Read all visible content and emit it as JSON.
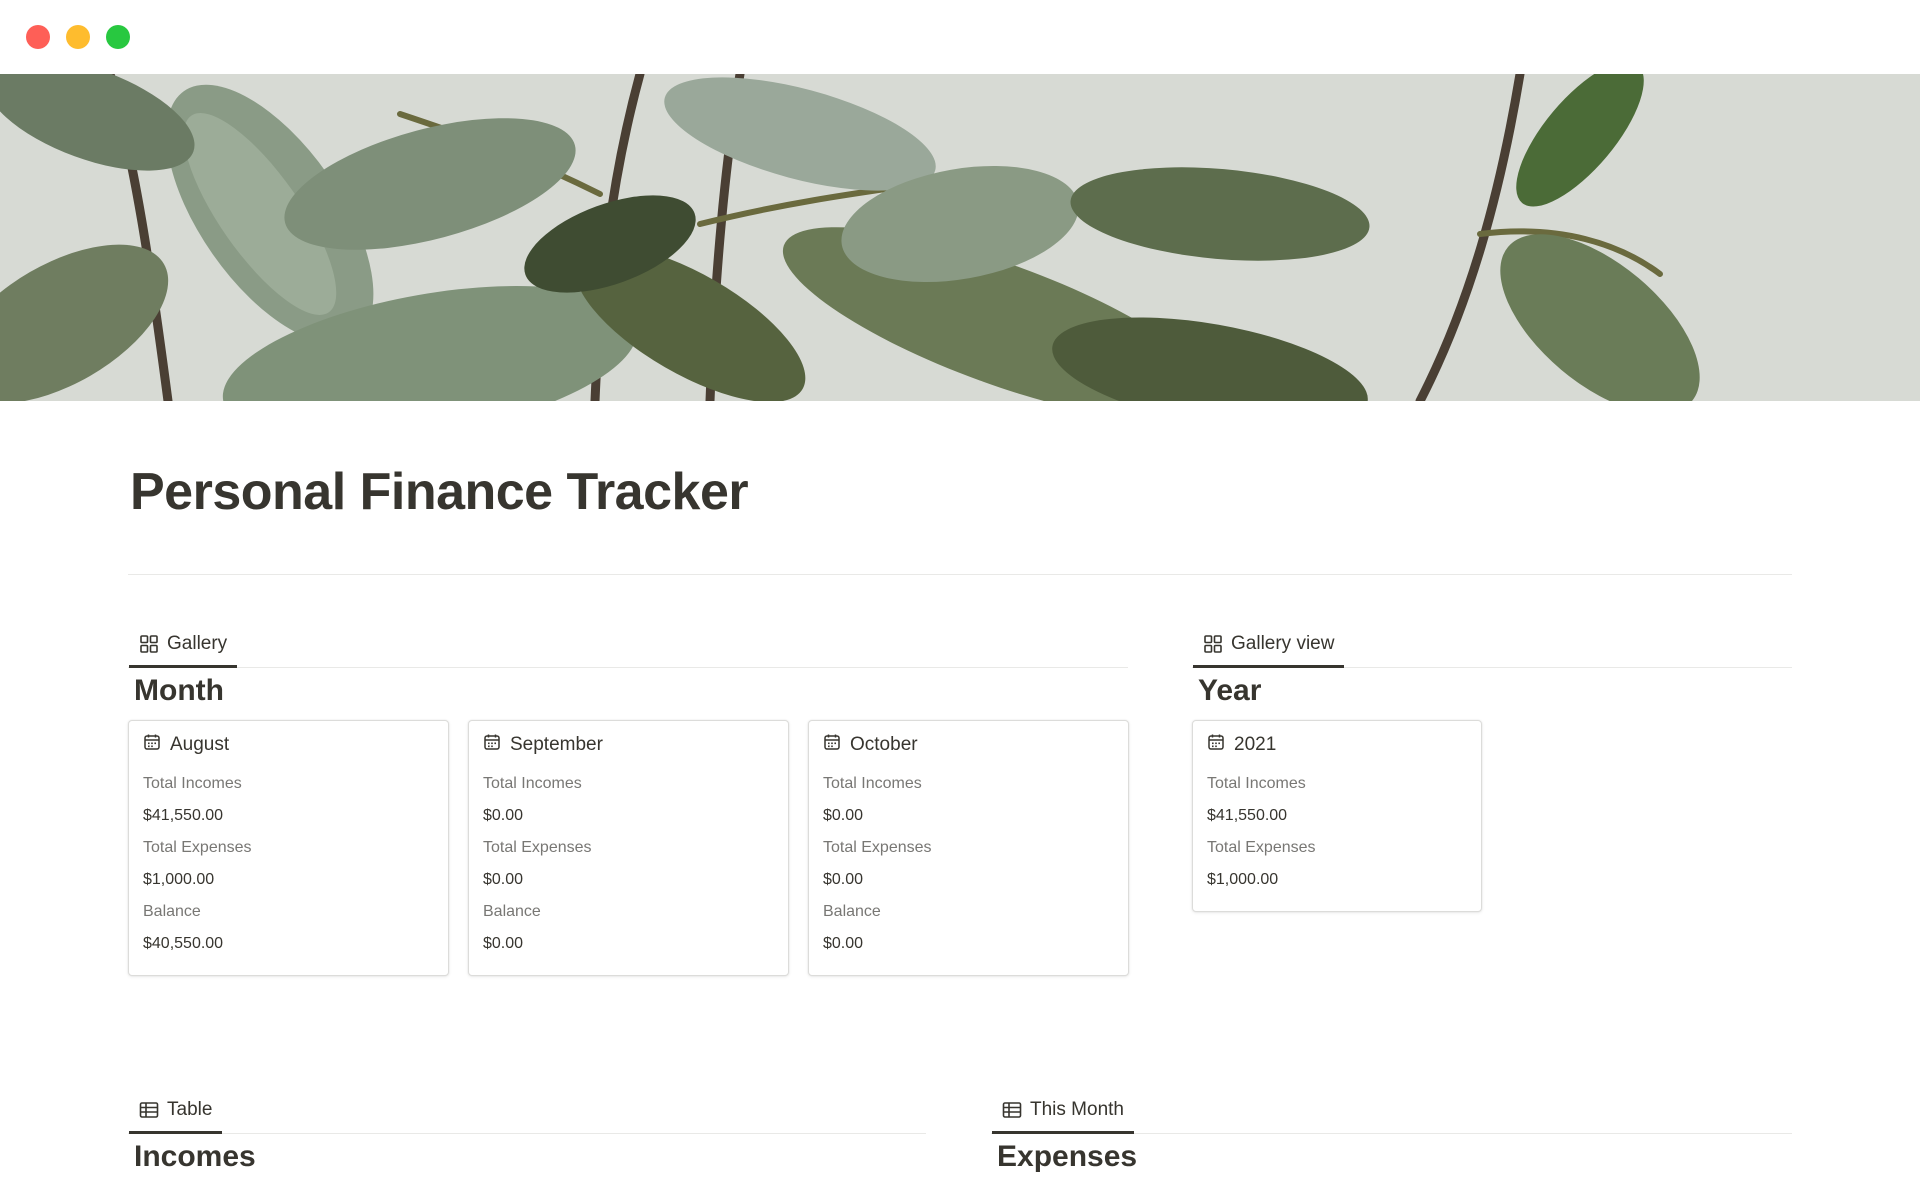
{
  "window": {
    "controls": [
      "close",
      "minimize",
      "zoom"
    ]
  },
  "cover": {
    "description_icon": "cover-image"
  },
  "page": {
    "title": "Personal Finance Tracker"
  },
  "month_view": {
    "tab_icon": "gallery-icon",
    "tab_label": "Gallery",
    "title": "Month",
    "cards": [
      {
        "name": "August",
        "total_incomes_label": "Total Incomes",
        "total_incomes": "$41,550.00",
        "total_expenses_label": "Total Expenses",
        "total_expenses": "$1,000.00",
        "balance_label": "Balance",
        "balance": "$40,550.00"
      },
      {
        "name": "September",
        "total_incomes_label": "Total Incomes",
        "total_incomes": "$0.00",
        "total_expenses_label": "Total Expenses",
        "total_expenses": "$0.00",
        "balance_label": "Balance",
        "balance": "$0.00"
      },
      {
        "name": "October",
        "total_incomes_label": "Total Incomes",
        "total_incomes": "$0.00",
        "total_expenses_label": "Total Expenses",
        "total_expenses": "$0.00",
        "balance_label": "Balance",
        "balance": "$0.00"
      }
    ]
  },
  "year_view": {
    "tab_icon": "gallery-icon",
    "tab_label": "Gallery view",
    "title": "Year",
    "cards": [
      {
        "name": "2021",
        "total_incomes_label": "Total Incomes",
        "total_incomes": "$41,550.00",
        "total_expenses_label": "Total Expenses",
        "total_expenses": "$1,000.00"
      }
    ]
  },
  "incomes_view": {
    "tab_icon": "table-icon",
    "tab_label": "Table",
    "title": "Incomes"
  },
  "expenses_view": {
    "tab_icon": "table-icon",
    "tab_label": "This Month",
    "title": "Expenses"
  },
  "colors": {
    "text": "#37352f",
    "muted": "#787774",
    "divider": "#e9e9e7",
    "close": "#fe5f57",
    "minimize": "#febc2e",
    "zoom": "#28c840"
  }
}
